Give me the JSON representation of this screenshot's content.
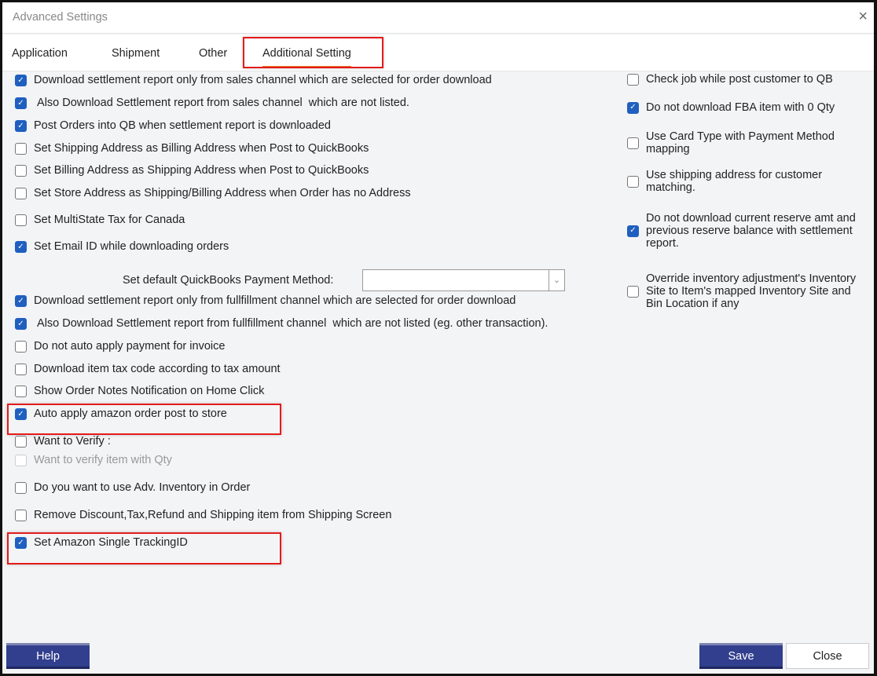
{
  "window": {
    "title": "Advanced Settings",
    "close_icon": "×"
  },
  "tabs": [
    {
      "label": "Application"
    },
    {
      "label": "Shipment"
    },
    {
      "label": "Other"
    },
    {
      "label": "Additional Setting",
      "active": true
    }
  ],
  "left_options": [
    {
      "label": "Download settlement report only from sales channel which are selected for order download",
      "checked": true
    },
    {
      "label": " Also Download Settlement report from sales channel  which are not listed.",
      "checked": true
    },
    {
      "label": "Post Orders into QB when settlement report is downloaded",
      "checked": true
    },
    {
      "label": "Set Shipping Address as Billing Address when Post to QuickBooks",
      "checked": false
    },
    {
      "label": "Set Billing Address as Shipping Address when Post to QuickBooks",
      "checked": false
    },
    {
      "label": "Set Store Address as Shipping/Billing Address when Order has no Address",
      "checked": false
    },
    {
      "label": "Set MultiState Tax for Canada",
      "checked": false
    },
    {
      "label": "Set Email ID while downloading orders",
      "checked": true
    },
    {
      "label": "Download settlement report only from fullfillment channel which are selected for order download",
      "checked": true
    },
    {
      "label": " Also Download Settlement report from fullfillment channel  which are not listed (eg. other transaction).",
      "checked": true
    },
    {
      "label": "Do not auto apply payment for invoice",
      "checked": false
    },
    {
      "label": "Download item tax code according to tax amount",
      "checked": false
    },
    {
      "label": "Show Order Notes Notification on Home Click",
      "checked": false
    },
    {
      "label": "Auto apply amazon order post to store",
      "checked": true
    },
    {
      "label": "Want to Verify :",
      "checked": false
    },
    {
      "label": "Want to verify item with Qty",
      "checked": false,
      "disabled": true
    },
    {
      "label": "Do you want to use Adv. Inventory in Order",
      "checked": false
    },
    {
      "label": "Remove Discount,Tax,Refund and Shipping item from Shipping Screen",
      "checked": false
    },
    {
      "label": "Set Amazon Single TrackingID",
      "checked": true
    }
  ],
  "payment_method": {
    "label": "Set default QuickBooks Payment Method:",
    "value": ""
  },
  "right_options": [
    {
      "label": "Check job while post customer to QB",
      "checked": false
    },
    {
      "label": "Do not download FBA item with 0 Qty",
      "checked": true
    },
    {
      "label": "Use Card Type with Payment Method mapping",
      "checked": false
    },
    {
      "label": "Use shipping address for customer matching.",
      "checked": false
    },
    {
      "label": "Do not download current reserve amt and previous reserve balance with settlement report.",
      "checked": true
    },
    {
      "label": "Override inventory adjustment's Inventory Site to Item's mapped Inventory Site and Bin Location if any",
      "checked": false
    }
  ],
  "buttons": {
    "help": "Help",
    "save": "Save",
    "close": "Close"
  },
  "colors": {
    "accent": "#323f8e",
    "checkbox": "#1f5fbf",
    "highlight": "#e31b1b",
    "tab_underline": "#e87722"
  }
}
